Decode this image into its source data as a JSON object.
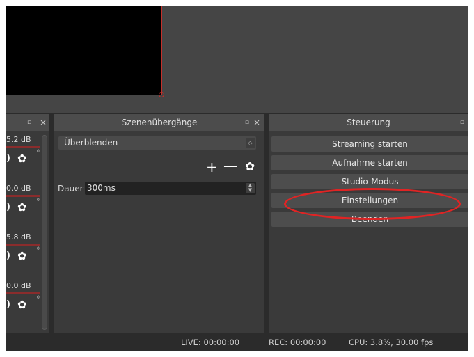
{
  "docks": {
    "mixer": {
      "channels": [
        {
          "db": "5.2 dB",
          "tick": "0"
        },
        {
          "db": "0.0 dB",
          "tick": "0"
        },
        {
          "db": "5.8 dB",
          "tick": "0"
        },
        {
          "db": "0.0 dB",
          "tick": "0"
        }
      ],
      "volume_glyph": ")",
      "gear_glyph": "✿"
    },
    "transitions": {
      "title": "Szenenübergänge",
      "selected": "Überblenden",
      "add_label": "+",
      "remove_label": "—",
      "gear_glyph": "✿",
      "duration_label": "Dauer",
      "duration_value": "300ms"
    },
    "controls": {
      "title": "Steuerung",
      "buttons": [
        "Streaming starten",
        "Aufnahme starten",
        "Studio-Modus",
        "Einstellungen",
        "Beenden"
      ]
    },
    "float_glyph": "▫",
    "close_glyph": "×"
  },
  "statusbar": {
    "live": "LIVE: 00:00:00",
    "rec": "REC: 00:00:00",
    "cpu": "CPU: 3.8%, 30.00 fps"
  },
  "colors": {
    "background": "#2b2b2b",
    "dock": "#3a3a3a",
    "button": "#4d4d4d",
    "preview_border": "#c4302b",
    "annotation": "#e02424"
  }
}
